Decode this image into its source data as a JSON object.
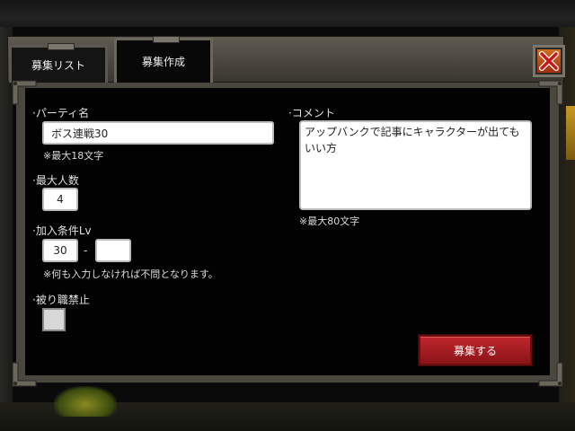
{
  "tabs": [
    {
      "label": "募集リスト",
      "active": false
    },
    {
      "label": "募集作成",
      "active": true
    }
  ],
  "close_icon": "close-x-icon",
  "form": {
    "party_name": {
      "label": "·パーティ名",
      "value": "ボス連戦30",
      "note": "※最大18文字"
    },
    "max_members": {
      "label": "·最大人数",
      "value": "4"
    },
    "join_level": {
      "label": "·加入条件Lv",
      "min_value": "30",
      "separator": "-",
      "max_value": "",
      "note": "※何も入力しなければ不問となります。"
    },
    "no_duplicate_job": {
      "label": "·被り職禁止",
      "checked": false
    },
    "comment": {
      "label": "·コメント",
      "value": "アップバンクで記事にキャラクターが出てもいい方",
      "note": "※最大80文字"
    }
  },
  "submit_label": "募集する",
  "colors": {
    "panel_bg": "#020202",
    "frame": "#4a473f",
    "submit": "#b01e24",
    "close": "#d06020"
  }
}
